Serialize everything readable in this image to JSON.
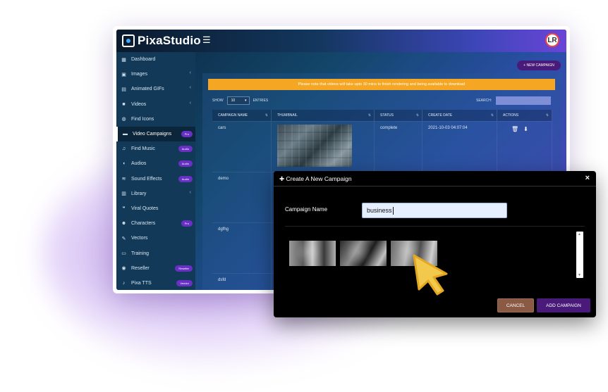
{
  "app": {
    "brand": "PixaStudio",
    "avatar_initials": "LR"
  },
  "sidebar": {
    "items": [
      {
        "label": "Dashboard",
        "icon": "dashboard-icon",
        "badge": "",
        "chevron": false,
        "active": false
      },
      {
        "label": "Images",
        "icon": "image-icon",
        "badge": "",
        "chevron": true,
        "active": false
      },
      {
        "label": "Animated GIFs",
        "icon": "film-icon",
        "badge": "",
        "chevron": true,
        "active": false
      },
      {
        "label": "Videos",
        "icon": "video-icon",
        "badge": "",
        "chevron": true,
        "active": false
      },
      {
        "label": "Find Icons",
        "icon": "palette-icon",
        "badge": "",
        "chevron": false,
        "active": false
      },
      {
        "label": "Video Campaigns",
        "icon": "folder-icon",
        "badge": "Pro",
        "chevron": false,
        "active": true
      },
      {
        "label": "Find Music",
        "icon": "music-icon",
        "badge": "Audio",
        "chevron": false,
        "active": false
      },
      {
        "label": "Audios",
        "icon": "headphones-icon",
        "badge": "Audio",
        "chevron": false,
        "active": false
      },
      {
        "label": "Sound Effects",
        "icon": "sound-effects-icon",
        "badge": "Audio",
        "chevron": false,
        "active": false
      },
      {
        "label": "Library",
        "icon": "library-icon",
        "badge": "",
        "chevron": true,
        "active": false
      },
      {
        "label": "Viral Quotes",
        "icon": "quote-icon",
        "badge": "",
        "chevron": false,
        "active": false
      },
      {
        "label": "Characters",
        "icon": "character-icon",
        "badge": "Pro",
        "chevron": false,
        "active": false
      },
      {
        "label": "Vectors",
        "icon": "brush-icon",
        "badge": "",
        "chevron": false,
        "active": false
      },
      {
        "label": "Training",
        "icon": "monitor-icon",
        "badge": "",
        "chevron": false,
        "active": false
      },
      {
        "label": "Reseller",
        "icon": "users-icon",
        "badge": "Reseller",
        "chevron": false,
        "active": false
      },
      {
        "label": "Pixa TTS",
        "icon": "mic-icon",
        "badge": "Vendor",
        "chevron": false,
        "active": false
      }
    ]
  },
  "main": {
    "new_campaign_label": "+ NEW CAMPAIGN",
    "notice": "Please note that videos will take upto 30 mins to finish rendering and being available to download",
    "show_label": "SHOW",
    "entries_value": "10",
    "entries_label": "ENTRIES",
    "search_label": "SEARCH:",
    "columns": [
      "CAMPAIGN NAME",
      "THUMBNAIL",
      "STATUS",
      "CREATE DATE",
      "ACTIONS"
    ],
    "rows": [
      {
        "name": "cars",
        "status": "complete",
        "date": "2021-10-03 04:07:04"
      },
      {
        "name": "demo",
        "status": "",
        "date": ""
      },
      {
        "name": "dgfhg",
        "status": "",
        "date": ""
      },
      {
        "name": "dsfd",
        "status": "",
        "date": ""
      }
    ]
  },
  "modal": {
    "title": "Create A New Campaign",
    "close_label": "×",
    "field_label": "Campaign Name",
    "field_value": "business",
    "cancel_label": "CANCEL",
    "add_label": "ADD CAMPAIGN"
  },
  "colors": {
    "accent": "#4a1a7a",
    "notice": "#f5a623",
    "cancel": "#8b5a45",
    "cursor": "#f2c94c"
  }
}
